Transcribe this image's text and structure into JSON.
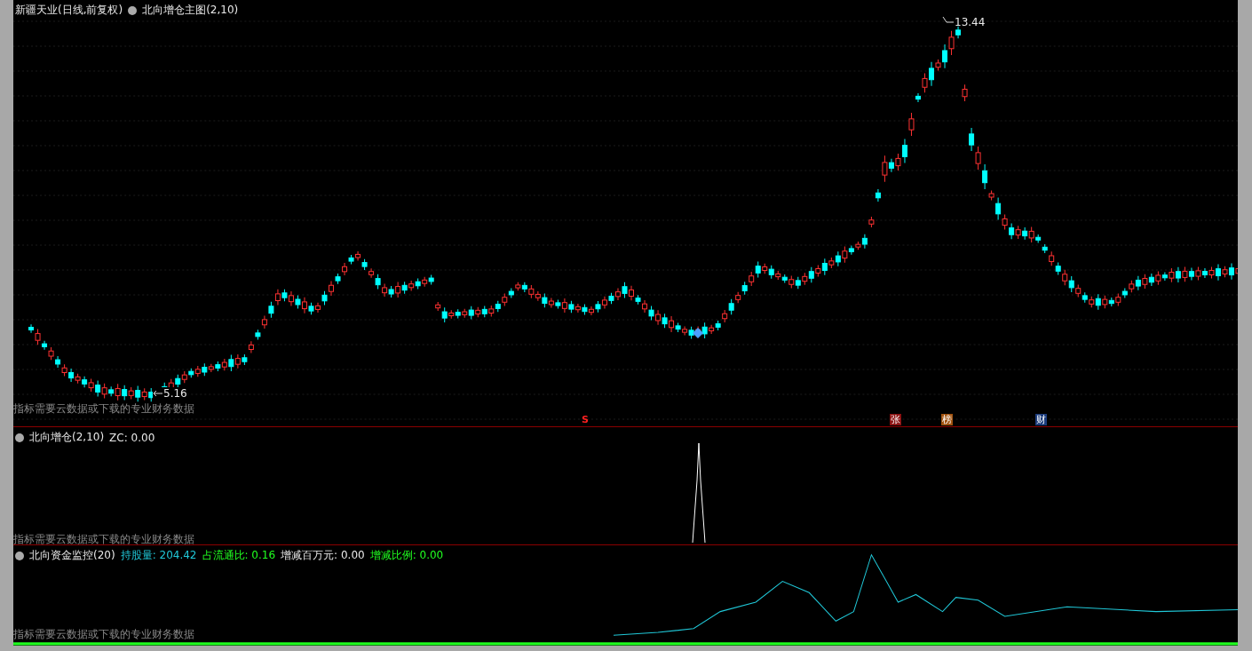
{
  "main_panel": {
    "stock": "新疆天业(日线,前复权)",
    "indicator": "北向增仓主图(2,10)",
    "notice": "指标需要云数据或下载的专业财务数据",
    "high_label": "13.44",
    "low_label": "5.16",
    "event_marks": [
      {
        "text": "S",
        "kind": "signal",
        "color": "#ff2020"
      },
      {
        "text": "张",
        "kind": "tag",
        "color": "#8b1212"
      },
      {
        "text": "榜",
        "kind": "tag",
        "color": "#a0520f"
      },
      {
        "text": "财",
        "kind": "tag",
        "color": "#1c3c7c"
      }
    ]
  },
  "increase_panel": {
    "indicator": "北向增仓(2,10)",
    "reading": "ZC: 0.00",
    "notice": "指标需要云数据或下载的专业财务数据"
  },
  "monitor_panel": {
    "indicator": "北向资金监控(20)",
    "notice": "指标需要云数据或下载的专业财务数据",
    "readings": [
      {
        "text": "持股量: 204.42",
        "color": "#20c8d8"
      },
      {
        "text": "占流通比: 0.16",
        "color": "#20ff20"
      },
      {
        "text": "增减百万元: 0.00",
        "color": "#e8e8e8"
      },
      {
        "text": "增减比例: 0.00",
        "color": "#20ff20"
      }
    ]
  }
}
